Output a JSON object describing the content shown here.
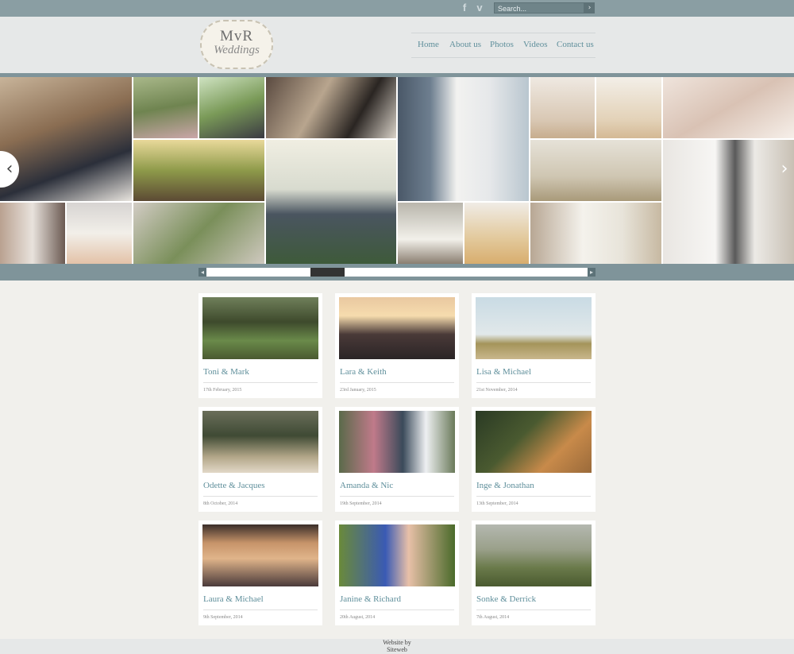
{
  "topbar": {
    "social_icons": [
      {
        "name": "facebook-icon",
        "glyph": "f"
      },
      {
        "name": "vimeo-icon",
        "glyph": "v"
      }
    ],
    "search": {
      "placeholder": "Search..."
    },
    "search_button_icon": "arrow-right-icon"
  },
  "logo": {
    "main": "MvR",
    "sub": "Weddings"
  },
  "nav": {
    "items": [
      "Home",
      "About us",
      "Photos",
      "Videos",
      "Contact us"
    ]
  },
  "colors": {
    "accent": "#5f8f9b",
    "bar": "#8a9ea3",
    "header_bg": "#e6e8e8",
    "page_bg": "#f1f0ec"
  },
  "gallery": {
    "prev_icon": "chevron-left-icon",
    "next_icon": "chevron-right-icon"
  },
  "cards": [
    {
      "name": "Toni & Mark",
      "date": "17th February, 2015"
    },
    {
      "name": "Lara & Keith",
      "date": "23rd January, 2015"
    },
    {
      "name": "Lisa & Michael",
      "date": "21st November, 2014"
    },
    {
      "name": "Odette & Jacques",
      "date": "8th October, 2014"
    },
    {
      "name": "Amanda & Nic",
      "date": "19th September, 2014"
    },
    {
      "name": "Inge & Jonathan",
      "date": "13th September, 2014"
    },
    {
      "name": "Laura & Michael",
      "date": "9th September, 2014"
    },
    {
      "name": "Janine & Richard",
      "date": "20th August, 2014"
    },
    {
      "name": "Sonke & Derrick",
      "date": "7th August, 2014"
    }
  ],
  "footer": {
    "line1": "Website by",
    "line2": "Siteweb"
  }
}
